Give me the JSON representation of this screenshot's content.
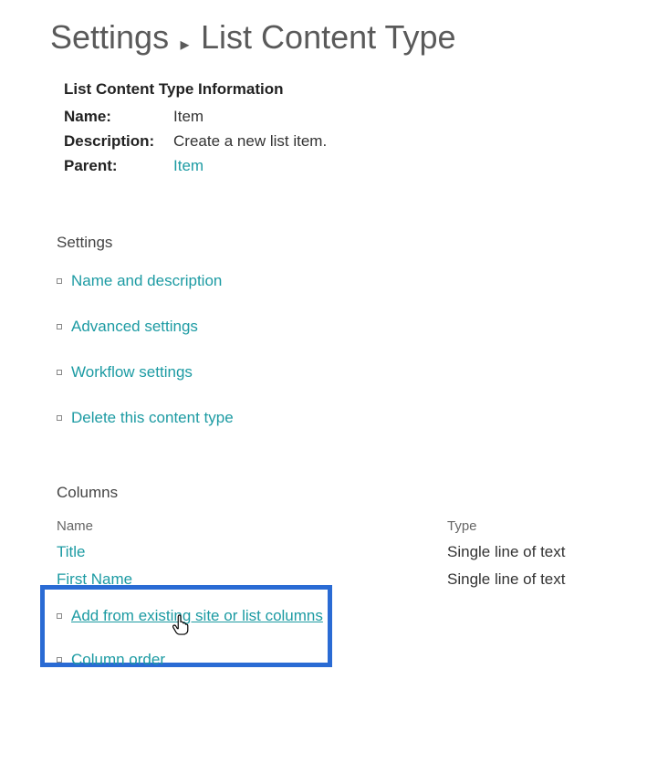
{
  "breadcrumb": {
    "settings": "Settings",
    "separator": "▸",
    "title": "List Content Type"
  },
  "info": {
    "heading": "List Content Type Information",
    "name_label": "Name:",
    "name_value": "Item",
    "description_label": "Description:",
    "description_value": "Create a new list item.",
    "parent_label": "Parent:",
    "parent_value": "Item"
  },
  "settings": {
    "heading": "Settings",
    "items": [
      "Name and description",
      "Advanced settings",
      "Workflow settings",
      "Delete this content type"
    ]
  },
  "columns": {
    "heading": "Columns",
    "headers": {
      "name": "Name",
      "type": "Type"
    },
    "rows": [
      {
        "name": "Title",
        "type": "Single line of text"
      },
      {
        "name": "First Name",
        "type": "Single line of text"
      }
    ],
    "actions": [
      "Add from existing site or list columns",
      "Column order"
    ]
  }
}
